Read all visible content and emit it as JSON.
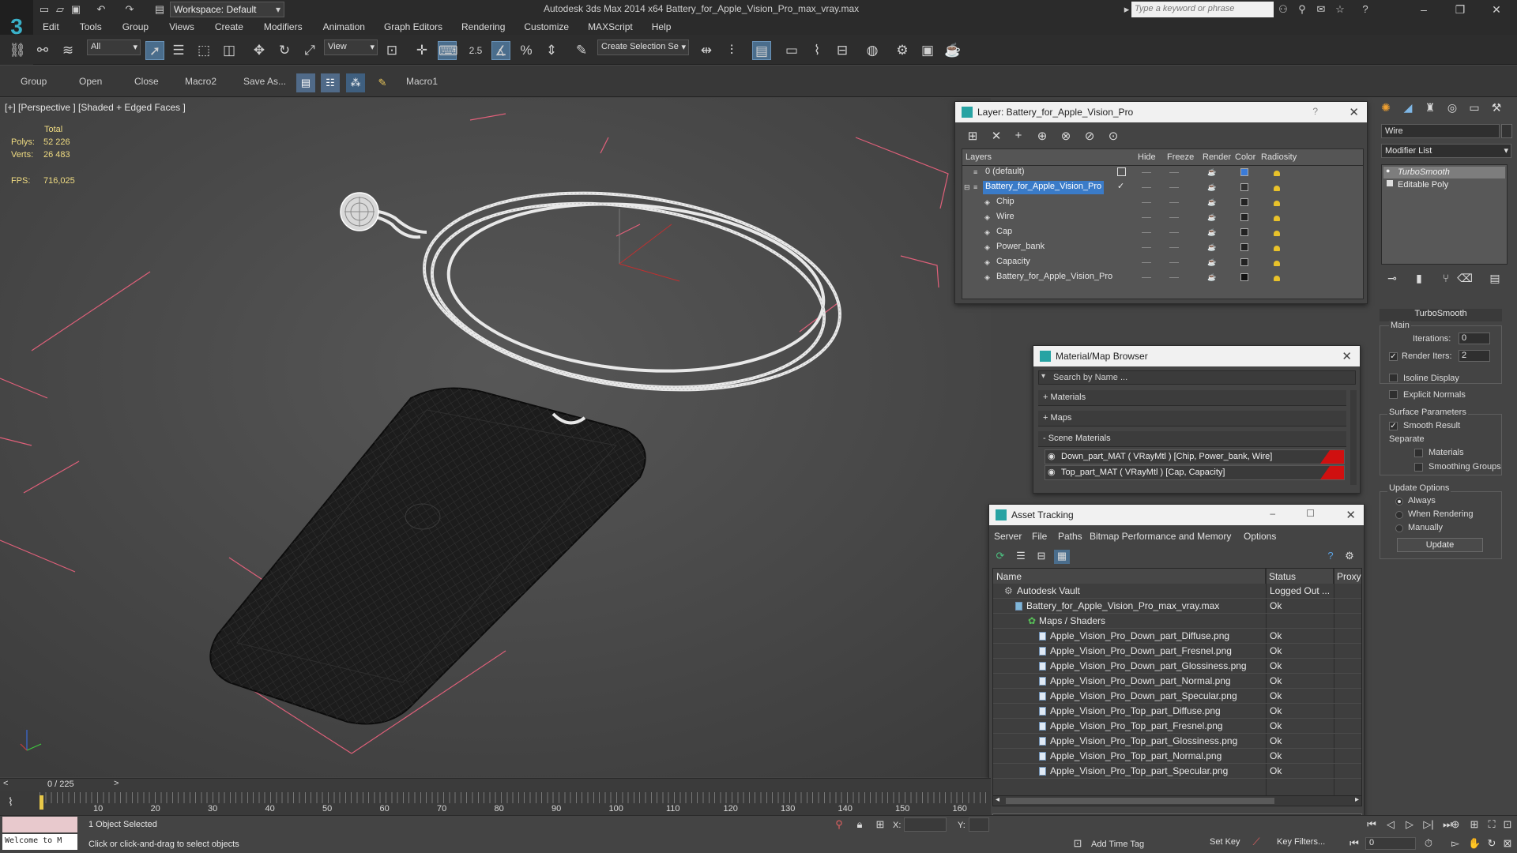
{
  "titlebar": {
    "workspace": "Workspace: Default",
    "title": "Autodesk 3ds Max  2014 x64     Battery_for_Apple_Vision_Pro_max_vray.max",
    "search_placeholder": "Type a keyword or phrase"
  },
  "menu": [
    "Edit",
    "Tools",
    "Group",
    "Views",
    "Create",
    "Modifiers",
    "Animation",
    "Graph Editors",
    "Rendering",
    "Customize",
    "MAXScript",
    "Help"
  ],
  "toolbar": {
    "filter_value": "All",
    "refcoord_value": "View",
    "snap_value": "2.5",
    "selection_set": "Create Selection Se"
  },
  "toolbar2": {
    "buttons": [
      "Group",
      "Open",
      "Close",
      "Macro2",
      "Save As...",
      "Macro1"
    ]
  },
  "viewport": {
    "label": "[+] [Perspective ] [Shaded + Edged Faces ]",
    "total_label": "Total",
    "polys_label": "Polys:",
    "polys_value": "52 226",
    "verts_label": "Verts:",
    "verts_value": "26 483",
    "fps_label": "FPS:",
    "fps_value": "716,025"
  },
  "layer_dialog": {
    "title": "Layer: Battery_for_Apple_Vision_Pro",
    "help": "?",
    "columns": [
      "Layers",
      "Hide",
      "Freeze",
      "Render",
      "Color",
      "Radiosity"
    ],
    "rows": [
      {
        "name": "0 (default)",
        "color": "#3a7bd8"
      },
      {
        "name": "Battery_for_Apple_Vision_Pro",
        "color": "#333333"
      },
      {
        "name": "Chip",
        "color": "#222222"
      },
      {
        "name": "Wire",
        "color": "#222222"
      },
      {
        "name": "Cap",
        "color": "#222222"
      },
      {
        "name": "Power_bank",
        "color": "#222222"
      },
      {
        "name": "Capacity",
        "color": "#222222"
      },
      {
        "name": "Battery_for_Apple_Vision_Pro",
        "color": "#111111"
      }
    ]
  },
  "material_browser": {
    "title": "Material/Map Browser",
    "search_placeholder": "Search by Name ...",
    "sections": [
      "+ Materials",
      "+ Maps",
      "- Scene Materials"
    ],
    "materials": [
      "Down_part_MAT  ( VRayMtl )  [Chip, Power_bank, Wire]",
      "Top_part_MAT  ( VRayMtl )  [Cap, Capacity]"
    ]
  },
  "asset_tracking": {
    "title": "Asset Tracking",
    "menu": [
      "Server",
      "File",
      "Paths",
      "Bitmap Performance and Memory",
      "Options"
    ],
    "columns": [
      "Name",
      "Status",
      "Proxy"
    ],
    "rows": [
      {
        "name": "Autodesk Vault",
        "status": "Logged Out ..."
      },
      {
        "name": "Battery_for_Apple_Vision_Pro_max_vray.max",
        "status": "Ok"
      },
      {
        "name": "Maps / Shaders",
        "status": ""
      },
      {
        "name": "Apple_Vision_Pro_Down_part_Diffuse.png",
        "status": "Ok"
      },
      {
        "name": "Apple_Vision_Pro_Down_part_Fresnel.png",
        "status": "Ok"
      },
      {
        "name": "Apple_Vision_Pro_Down_part_Glossiness.png",
        "status": "Ok"
      },
      {
        "name": "Apple_Vision_Pro_Down_part_Normal.png",
        "status": "Ok"
      },
      {
        "name": "Apple_Vision_Pro_Down_part_Specular.png",
        "status": "Ok"
      },
      {
        "name": "Apple_Vision_Pro_Top_part_Diffuse.png",
        "status": "Ok"
      },
      {
        "name": "Apple_Vision_Pro_Top_part_Fresnel.png",
        "status": "Ok"
      },
      {
        "name": "Apple_Vision_Pro_Top_part_Glossiness.png",
        "status": "Ok"
      },
      {
        "name": "Apple_Vision_Pro_Top_part_Normal.png",
        "status": "Ok"
      },
      {
        "name": "Apple_Vision_Pro_Top_part_Specular.png",
        "status": "Ok"
      }
    ]
  },
  "command_panel": {
    "object_name": "Wire",
    "modifier_list": "Modifier List",
    "stack": [
      "TurboSmooth",
      "Editable Poly"
    ],
    "turbosmooth_title": "TurboSmooth",
    "main_label": "Main",
    "iterations_label": "Iterations:",
    "iterations_value": "0",
    "render_iters_label": "Render Iters:",
    "render_iters_value": "2",
    "isoline": "Isoline Display",
    "explicit_normals": "Explicit Normals",
    "surface_params": "Surface Parameters",
    "smooth_result": "Smooth Result",
    "separate": "Separate",
    "materials": "Materials",
    "smoothing_groups": "Smoothing Groups",
    "update_options": "Update Options",
    "always": "Always",
    "when_rendering": "When Rendering",
    "manually": "Manually",
    "update_button": "Update"
  },
  "timeline": {
    "frame_counter": "0 / 225",
    "ticks": [
      "10",
      "20",
      "30",
      "40",
      "50",
      "60",
      "70",
      "80",
      "90",
      "100",
      "110",
      "120",
      "130",
      "140",
      "150",
      "160"
    ]
  },
  "status": {
    "maxscript": "Welcome to M",
    "selected": "1 Object Selected",
    "prompt": "Click or click-and-drag to select objects",
    "x_label": "X:",
    "y_label": "Y:",
    "add_time_tag": "Add Time Tag",
    "set_key": "Set Key",
    "key_filters": "Key Filters...",
    "frame_value": "0"
  }
}
